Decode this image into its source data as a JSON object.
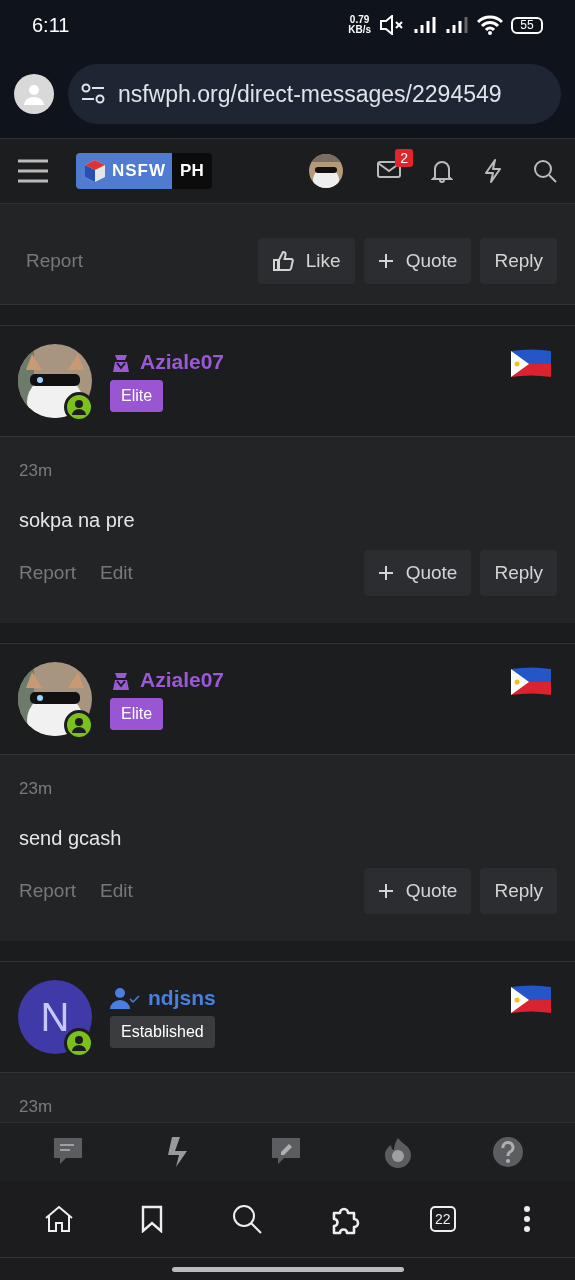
{
  "status_bar": {
    "time": "6:11",
    "net_speed": "0.79",
    "net_unit": "KB/s",
    "battery": "55"
  },
  "browser": {
    "url": "nsfwph.org/direct-messages/2294549"
  },
  "header": {
    "logo_main": "NSFW",
    "logo_suffix": "PH",
    "inbox_badge": "2"
  },
  "first_post": {
    "actions": [
      "Report"
    ],
    "buttons": [
      {
        "kind": "like",
        "label": "Like"
      },
      {
        "kind": "quote",
        "label": "Quote"
      },
      {
        "kind": "reply",
        "label": "Reply"
      }
    ]
  },
  "messages": [
    {
      "user": {
        "name": "Aziale07",
        "kind": "staff",
        "color": "#9b59d6",
        "online": true,
        "badge": {
          "label": "Elite",
          "color": "#9a55d3"
        }
      },
      "time": "23m",
      "text": "sokpa na pre",
      "actions": [
        "Report",
        "Edit"
      ],
      "buttons": [
        {
          "kind": "quote",
          "label": "Quote"
        },
        {
          "kind": "reply",
          "label": "Reply"
        }
      ]
    },
    {
      "user": {
        "name": "Aziale07",
        "kind": "staff",
        "color": "#9b59d6",
        "online": true,
        "badge": {
          "label": "Elite",
          "color": "#9a55d3"
        }
      },
      "time": "23m",
      "text": "send gcash",
      "actions": [
        "Report",
        "Edit"
      ],
      "buttons": [
        {
          "kind": "quote",
          "label": "Quote"
        },
        {
          "kind": "reply",
          "label": "Reply"
        }
      ]
    },
    {
      "user": {
        "name": "ndjsns",
        "kind": "member",
        "color": "#4a7fe0",
        "avatar": {
          "kind": "letter",
          "letter": "N"
        },
        "online": true,
        "badge": {
          "label": "Established",
          "color": "#3b3c3f"
        }
      },
      "time": "23m"
    }
  ],
  "browser_nav": {
    "tab_count": "22"
  }
}
